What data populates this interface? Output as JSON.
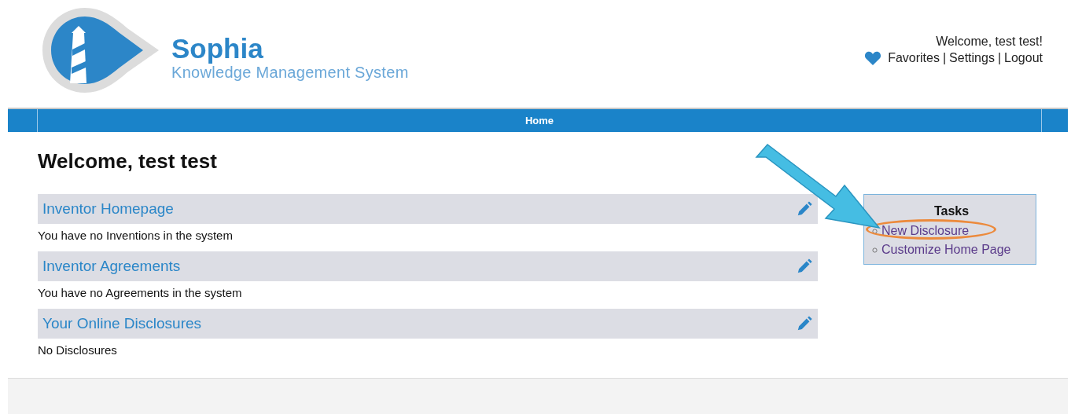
{
  "logo": {
    "title": "Sophia",
    "subtitle": "Knowledge Management System"
  },
  "user_menu": {
    "greeting": "Welcome, test test!",
    "links": [
      "Favorites",
      "Settings",
      "Logout"
    ],
    "separator": "|"
  },
  "nav": {
    "items": [
      {
        "label": "Home",
        "selected": true
      }
    ]
  },
  "heading": "Welcome, test test",
  "sections": [
    {
      "title": "Inventor Homepage",
      "body": "You have no Inventions in the system"
    },
    {
      "title": "Inventor Agreements",
      "body": "You have no Agreements in the system"
    },
    {
      "title": "Your Online Disclosures",
      "body": "No Disclosures"
    }
  ],
  "tasks": {
    "title": "Tasks",
    "items": [
      {
        "label": "New Disclosure",
        "highlighted": true
      },
      {
        "label": "Customize Home Page",
        "highlighted": false
      }
    ]
  }
}
